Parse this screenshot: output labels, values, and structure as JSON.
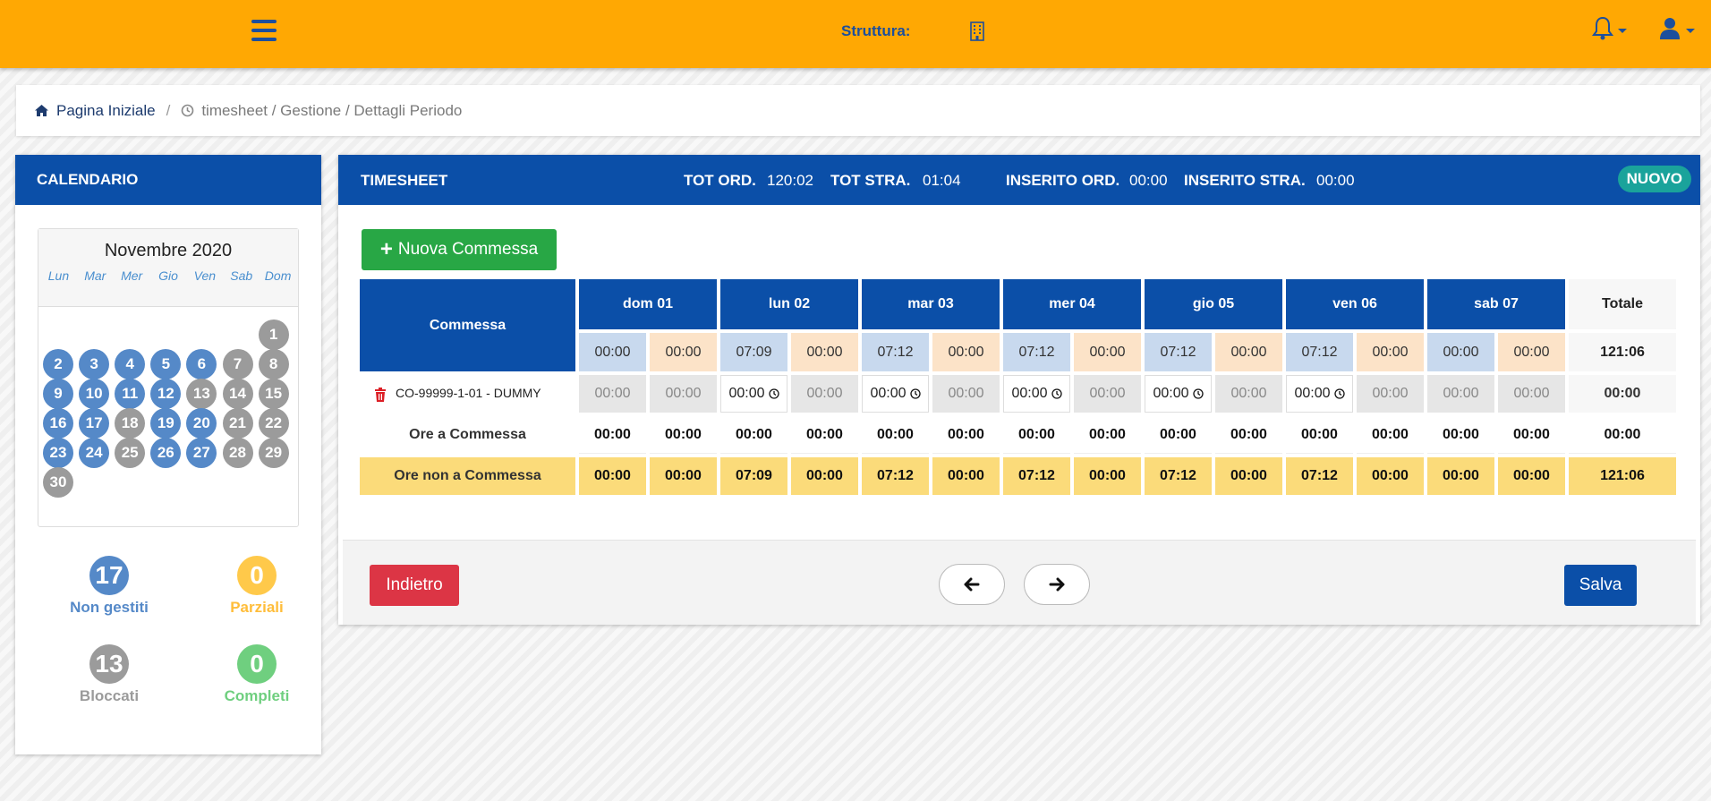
{
  "topbar": {
    "struttura_label": "Struttura:"
  },
  "breadcrumb": {
    "home": "Pagina Iniziale",
    "separator": "/",
    "trail": "timesheet / Gestione / Dettagli Periodo"
  },
  "calendar": {
    "title": "CALENDARIO",
    "month": "Novembre 2020",
    "weekdays": [
      "Lun",
      "Mar",
      "Mer",
      "Gio",
      "Ven",
      "Sab",
      "Dom"
    ],
    "days": [
      {
        "n": "1",
        "s": "grey"
      },
      {
        "n": "2",
        "s": "blue"
      },
      {
        "n": "3",
        "s": "blue"
      },
      {
        "n": "4",
        "s": "blue"
      },
      {
        "n": "5",
        "s": "blue"
      },
      {
        "n": "6",
        "s": "blue"
      },
      {
        "n": "7",
        "s": "grey"
      },
      {
        "n": "8",
        "s": "grey"
      },
      {
        "n": "9",
        "s": "blue"
      },
      {
        "n": "10",
        "s": "blue"
      },
      {
        "n": "11",
        "s": "blue"
      },
      {
        "n": "12",
        "s": "blue"
      },
      {
        "n": "13",
        "s": "grey"
      },
      {
        "n": "14",
        "s": "grey"
      },
      {
        "n": "15",
        "s": "grey"
      },
      {
        "n": "16",
        "s": "blue"
      },
      {
        "n": "17",
        "s": "blue"
      },
      {
        "n": "18",
        "s": "grey"
      },
      {
        "n": "19",
        "s": "blue"
      },
      {
        "n": "20",
        "s": "blue"
      },
      {
        "n": "21",
        "s": "grey"
      },
      {
        "n": "22",
        "s": "grey"
      },
      {
        "n": "23",
        "s": "blue"
      },
      {
        "n": "24",
        "s": "blue"
      },
      {
        "n": "25",
        "s": "grey"
      },
      {
        "n": "26",
        "s": "blue"
      },
      {
        "n": "27",
        "s": "blue"
      },
      {
        "n": "28",
        "s": "grey"
      },
      {
        "n": "29",
        "s": "grey"
      },
      {
        "n": "30",
        "s": "grey"
      }
    ],
    "stats": {
      "non_gestiti": {
        "count": "17",
        "label": "Non gestiti"
      },
      "parziali": {
        "count": "0",
        "label": "Parziali"
      },
      "bloccati": {
        "count": "13",
        "label": "Bloccati"
      },
      "completi": {
        "count": "0",
        "label": "Completi"
      }
    }
  },
  "timesheet": {
    "title": "TIMESHEET",
    "tot_ord_label": "TOT ORD.",
    "tot_ord_value": "120:02",
    "tot_stra_label": "TOT STRA.",
    "tot_stra_value": "01:04",
    "ins_ord_label": "INSERITO ORD.",
    "ins_ord_value": "00:00",
    "ins_stra_label": "INSERITO STRA.",
    "ins_stra_value": "00:00",
    "status_badge": "NUOVO",
    "new_button": "Nuova Commessa",
    "commessa_header": "Commessa",
    "totale_header": "Totale",
    "days": [
      "dom 01",
      "lun 02",
      "mar 03",
      "mer 04",
      "gio 05",
      "ven 06",
      "sab 07"
    ],
    "planned": [
      "00:00",
      "00:00",
      "07:09",
      "00:00",
      "07:12",
      "00:00",
      "07:12",
      "00:00",
      "07:12",
      "00:00",
      "07:12",
      "00:00",
      "00:00",
      "00:00"
    ],
    "planned_total": "121:06",
    "commesse": [
      {
        "name": "CO-99999-1-01 - DUMMY",
        "values": [
          "00:00",
          "00:00",
          "00:00",
          "00:00",
          "00:00",
          "00:00",
          "00:00",
          "00:00",
          "00:00",
          "00:00",
          "00:00",
          "00:00",
          "00:00",
          "00:00"
        ],
        "editable": [
          false,
          false,
          true,
          false,
          true,
          false,
          true,
          false,
          true,
          false,
          true,
          false,
          false,
          false
        ],
        "total": "00:00"
      }
    ],
    "ore_commessa_label": "Ore a Commessa",
    "ore_commessa": [
      "00:00",
      "00:00",
      "00:00",
      "00:00",
      "00:00",
      "00:00",
      "00:00",
      "00:00",
      "00:00",
      "00:00",
      "00:00",
      "00:00",
      "00:00",
      "00:00"
    ],
    "ore_commessa_total": "00:00",
    "ore_non_commessa_label": "Ore non a Commessa",
    "ore_non_commessa": [
      "00:00",
      "00:00",
      "07:09",
      "00:00",
      "07:12",
      "00:00",
      "07:12",
      "00:00",
      "07:12",
      "00:00",
      "07:12",
      "00:00",
      "00:00",
      "00:00"
    ],
    "ore_non_commessa_total": "121:06",
    "back_button": "Indietro",
    "save_button": "Salva"
  },
  "colors": {
    "topbar": "#ffa803",
    "primary": "#0b4fa8",
    "success": "#28a745",
    "danger": "#dc3545",
    "badge": "#1aa39b",
    "highlight_row": "#fbdb7a"
  }
}
